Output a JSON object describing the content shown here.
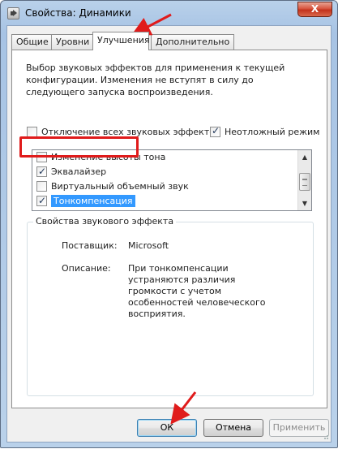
{
  "window": {
    "title": "Свойства: Динамики",
    "close_label": "X"
  },
  "tabs": [
    {
      "label": "Общие"
    },
    {
      "label": "Уровни"
    },
    {
      "label": "Улучшения"
    },
    {
      "label": "Дополнительно"
    }
  ],
  "enhancements": {
    "description": "Выбор звуковых эффектов для применения к текущей конфигурации. Изменения не вступят в силу до следующего запуска воспроизведения.",
    "disable_all_label": "Отключение всех звуковых эффектов",
    "disable_all_checked": false,
    "immediate_mode_label": "Неотложный режим",
    "immediate_mode_checked": true,
    "effects": [
      {
        "label": "Изменение высоты тона",
        "checked": false
      },
      {
        "label": "Эквалайзер",
        "checked": true
      },
      {
        "label": "Виртуальный объемный звук",
        "checked": false
      },
      {
        "label": "Тонкомпенсация",
        "checked": true,
        "selected": true
      }
    ],
    "properties": {
      "group_title": "Свойства звукового эффекта",
      "provider_label": "Поставщик:",
      "provider_value": "Microsoft",
      "description_label": "Описание:",
      "description_value": "При тонкомпенсации устраняются различия громкости с учетом особенностей человеческого восприятия."
    }
  },
  "buttons": {
    "ok": "ОК",
    "cancel": "Отмена",
    "apply": "Применить"
  },
  "colors": {
    "highlight": "#3399ff",
    "annotation_red": "#e01b1b"
  }
}
